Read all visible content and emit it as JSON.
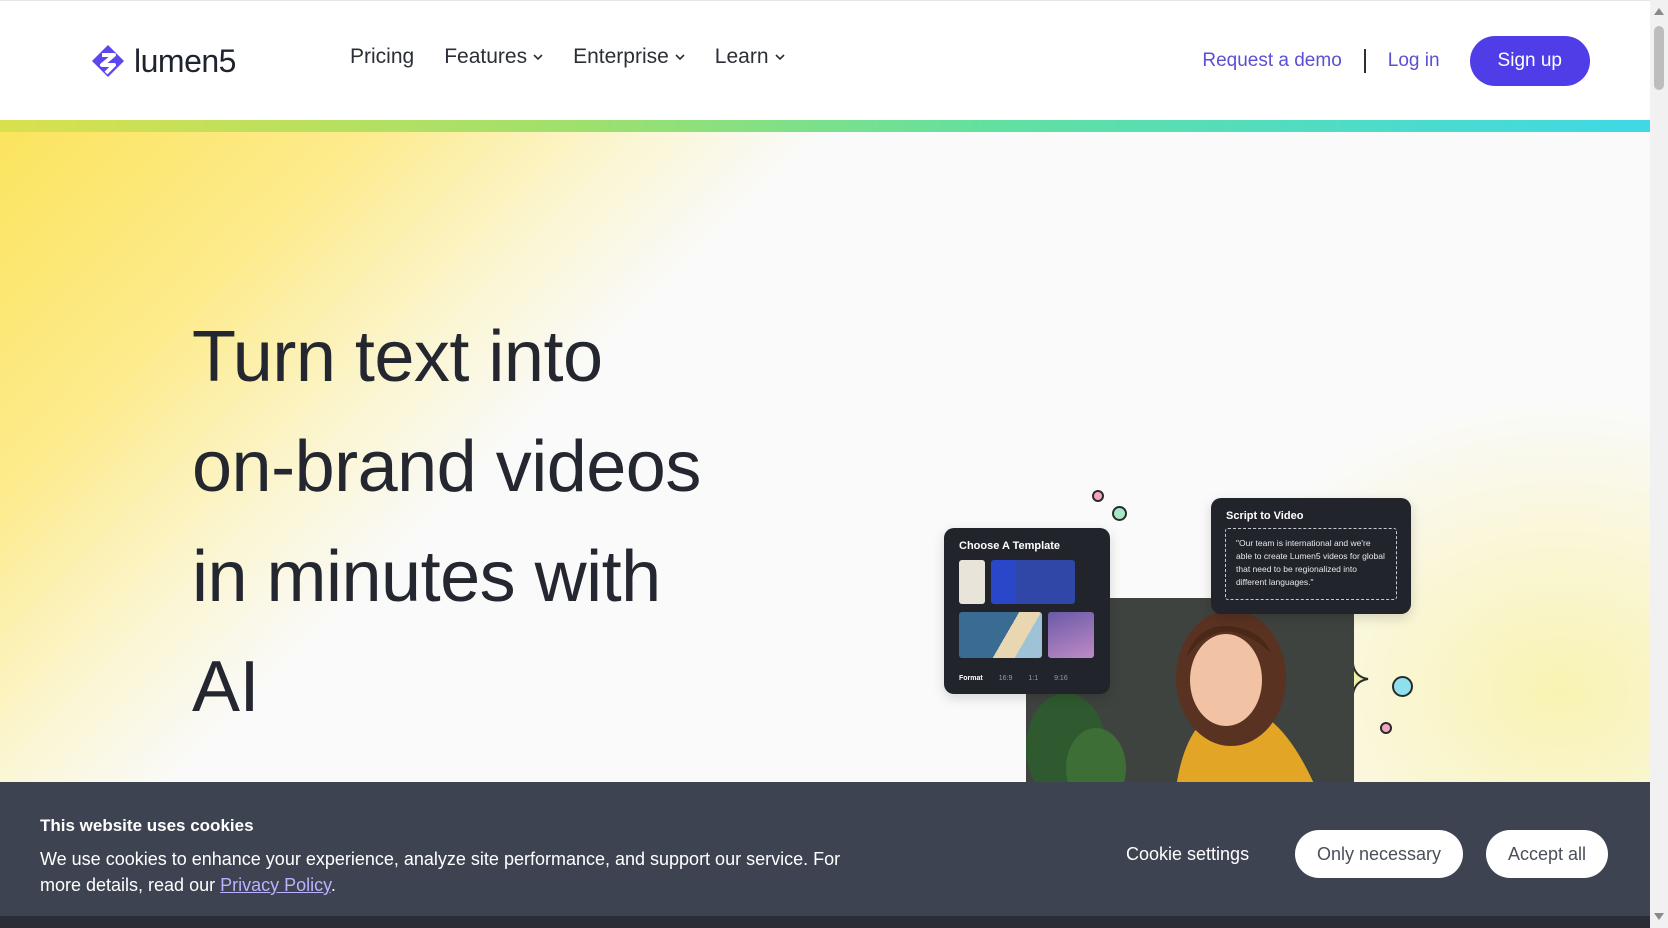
{
  "header": {
    "logo_text": "lumen5",
    "nav": [
      {
        "label": "Pricing",
        "dropdown": false
      },
      {
        "label": "Features",
        "dropdown": true
      },
      {
        "label": "Enterprise",
        "dropdown": true
      },
      {
        "label": "Learn",
        "dropdown": true
      }
    ],
    "request_demo": "Request a demo",
    "login": "Log in",
    "signup": "Sign up"
  },
  "hero": {
    "headline_lines": [
      "Turn text into",
      "on-brand videos",
      "in minutes with",
      "AI"
    ]
  },
  "illustration": {
    "template_card": {
      "title": "Choose A Template",
      "format_label": "Format",
      "formats": [
        "16:9",
        "1:1",
        "9:16"
      ]
    },
    "script_card": {
      "title": "Script to Video",
      "quote": "\"Our team is international and we're able to create Lumen5 videos for global that need to be regionalized into different languages.\""
    }
  },
  "cookie_banner": {
    "title": "This website uses cookies",
    "text_line": "We use cookies to enhance your experience, analyze site performance, and support our service. For more details, read our",
    "privacy_link": "Privacy Policy",
    "period": ".",
    "settings": "Cookie settings",
    "only_necessary": "Only necessary",
    "accept_all": "Accept all"
  },
  "colors": {
    "brand": "#4f3ee8",
    "link": "#5b4fd6",
    "banner_bg": "#3e4351"
  }
}
